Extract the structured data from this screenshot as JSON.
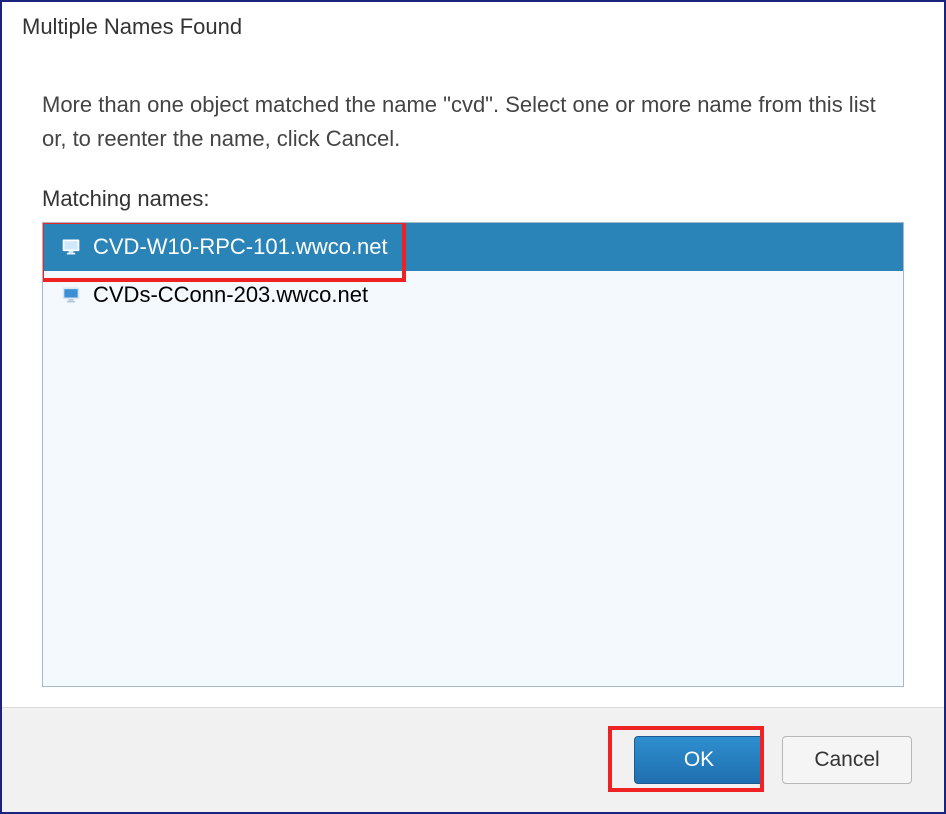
{
  "dialog": {
    "title": "Multiple Names Found",
    "instructions": "More than one object matched the name \"cvd\". Select one or more name from this list or, to reenter the name, click Cancel.",
    "list_label": "Matching names:",
    "items": [
      {
        "label": "CVD-W10-RPC-101.wwco.net",
        "selected": true
      },
      {
        "label": "CVDs-CConn-203.wwco.net",
        "selected": false
      }
    ],
    "ok_label": "OK",
    "cancel_label": "Cancel"
  }
}
